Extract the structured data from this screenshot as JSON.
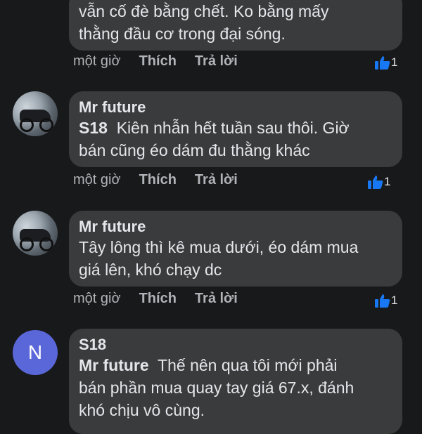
{
  "comments": [
    {
      "text_lines": [
        "vẫn cố đè bằng chết. Ko bằng mấy",
        "thằng đầu cơ trong đại sóng."
      ],
      "meta": {
        "time": "một giờ",
        "like": "Thích",
        "reply": "Trả lời"
      },
      "reaction_count": "1"
    },
    {
      "author": "Mr future",
      "tag": "S18",
      "text_lines": [
        "Kiên nhẫn hết tuần sau thôi. Giờ",
        "bán cũng éo dám đu thằng khác"
      ],
      "meta": {
        "time": "một giờ",
        "like": "Thích",
        "reply": "Trả lời"
      },
      "reaction_count": "1",
      "avatar_icon": "motorbike-photo-avatar"
    },
    {
      "author": "Mr future",
      "text_lines": [
        "Tây lông thì kê mua dưới, éo dám mua",
        "giá lên, khó chạy dc"
      ],
      "meta": {
        "time": "một giờ",
        "like": "Thích",
        "reply": "Trả lời"
      },
      "reaction_count": "1",
      "avatar_icon": "motorbike-photo-avatar"
    },
    {
      "author": "S18",
      "tag": "Mr future",
      "text_lines": [
        "Thế nên qua tôi mới phải",
        "bán phần mua quay tay giá 67.x, đánh",
        "khó chịu vô cùng."
      ],
      "avatar_letter": "N"
    }
  ],
  "colors": {
    "background": "#18191a",
    "bubble": "#3a3b3c",
    "like_blue": "#1877f2",
    "avatar_letter_bg": "#5a67d8"
  }
}
